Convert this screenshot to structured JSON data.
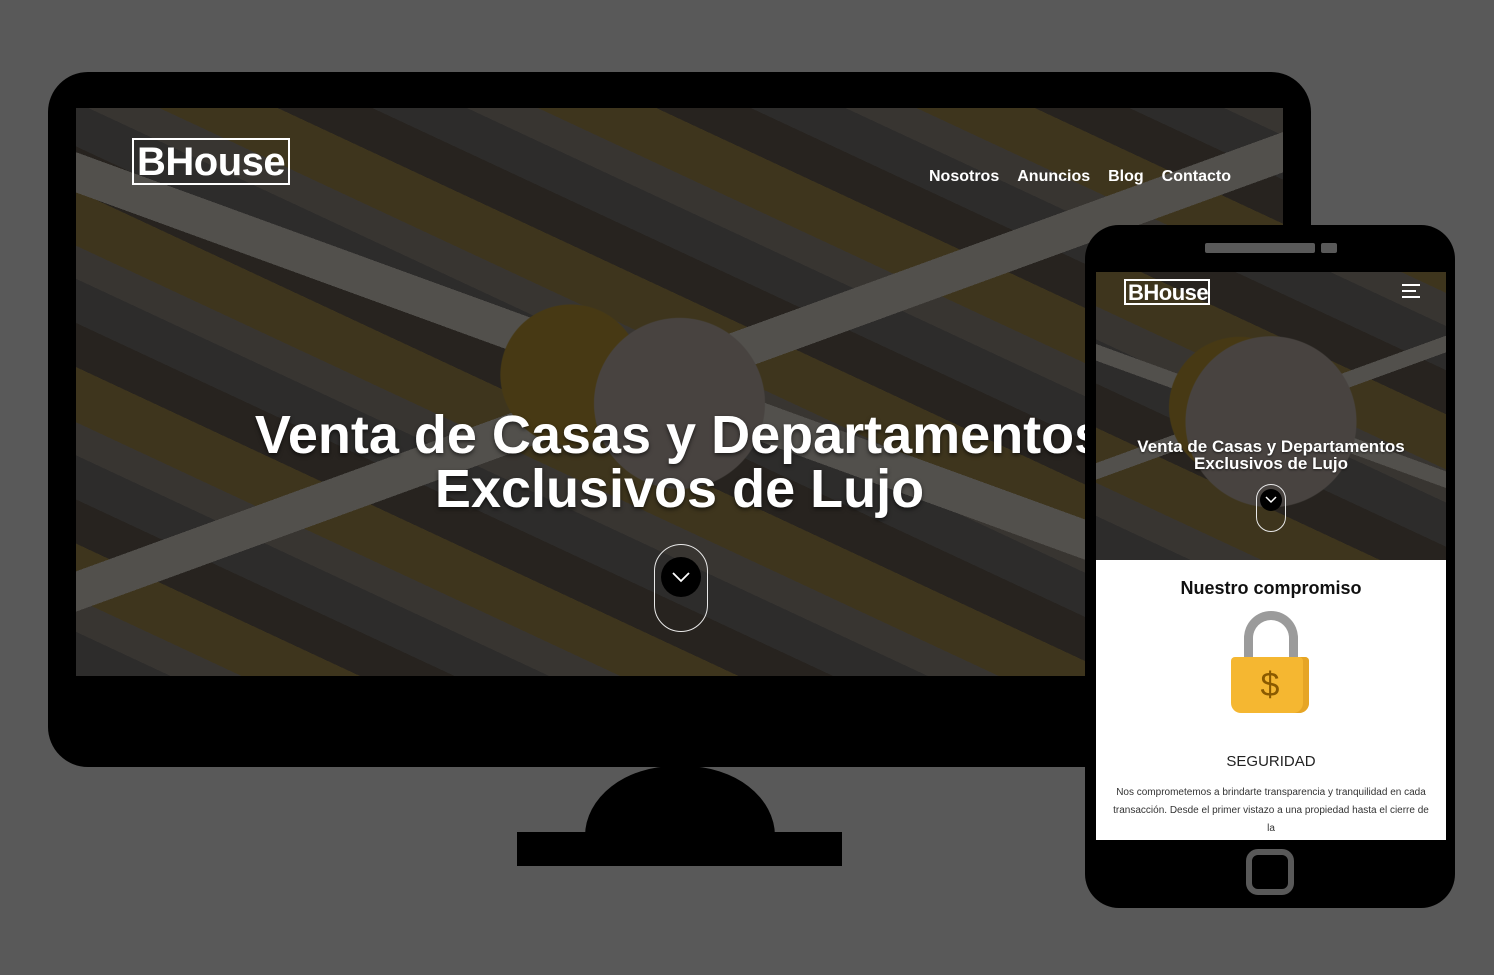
{
  "desktop": {
    "logo": "BHouse",
    "nav": [
      "Nosotros",
      "Anuncios",
      "Blog",
      "Contacto"
    ],
    "hero_line1": "Venta de Casas y Departamentos",
    "hero_line2": "Exclusivos de Lujo"
  },
  "mobile": {
    "logo": "BHouse",
    "hero_line1": "Venta de Casas y Departamentos",
    "hero_line2": "Exclusivos de Lujo",
    "section_title": "Nuestro compromiso",
    "lock_symbol": "$",
    "feature_caption": "SEGURIDAD",
    "feature_text": "Nos comprometemos a brindarte transparencia y tranquilidad en cada transacción. Desde el primer vistazo a una propiedad hasta el cierre de la"
  },
  "colors": {
    "background": "#595959",
    "lock_body": "#f5b731",
    "lock_shackle": "#9b9b9b"
  },
  "icons": [
    "chevron-down-icon",
    "hamburger-menu-icon",
    "lock-icon"
  ]
}
